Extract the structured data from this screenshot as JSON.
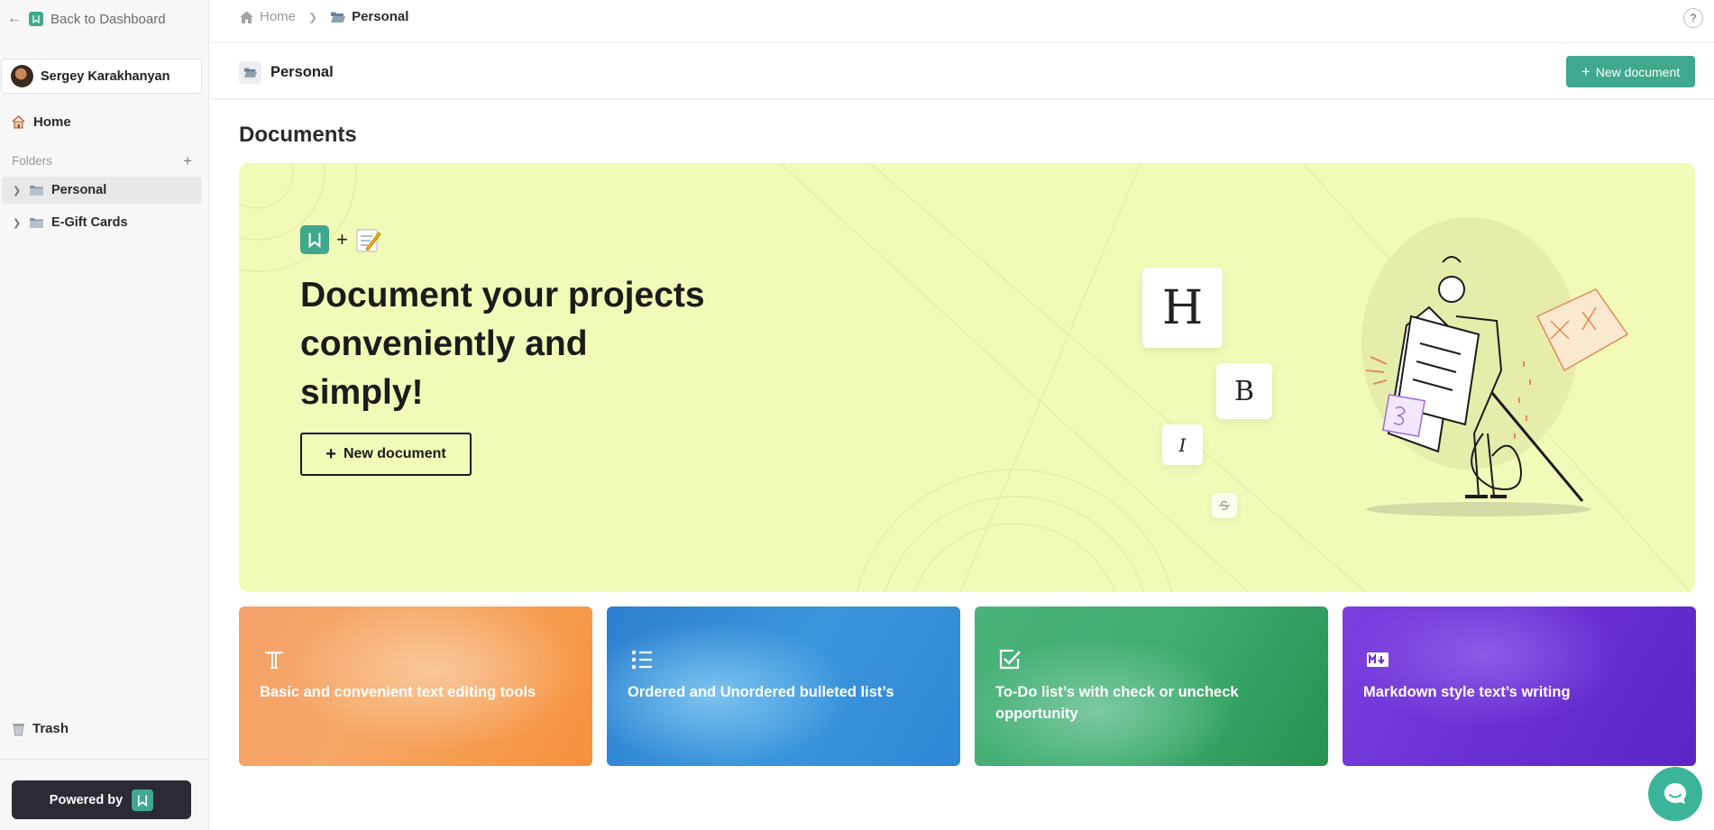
{
  "sidebar": {
    "back_label": "Back to Dashboard",
    "user_name": "Sergey Karakhanyan",
    "home_label": "Home",
    "folders_label": "Folders",
    "folders": [
      {
        "label": "Personal",
        "active": true
      },
      {
        "label": "E-Gift Cards",
        "active": false
      }
    ],
    "trash_label": "Trash",
    "powered_label": "Powered by"
  },
  "breadcrumb": {
    "home": "Home",
    "current": "Personal"
  },
  "help_label": "?",
  "folder_header": {
    "title": "Personal",
    "new_button": "New document"
  },
  "documents_title": "Documents",
  "hero": {
    "plus_sign": "+",
    "title": "Document your projects conveniently and simply!",
    "button": "New document",
    "tiles": [
      "H",
      "B",
      "I"
    ]
  },
  "features": [
    {
      "icon": "text-format-icon",
      "text": "Basic and convenient text editing tools"
    },
    {
      "icon": "bulleted-list-icon",
      "text": "Ordered and Unordered bulleted list’s"
    },
    {
      "icon": "checkbox-icon",
      "text": "To-Do list’s with check or uncheck opportunity"
    },
    {
      "icon": "markdown-icon",
      "text": "Markdown style text’s writing"
    }
  ],
  "colors": {
    "brand": "#3fa88d",
    "hero_bg": "#f1fab7",
    "sidebar_bg": "#f7f7f8",
    "powered_bg": "#2a2b33"
  }
}
